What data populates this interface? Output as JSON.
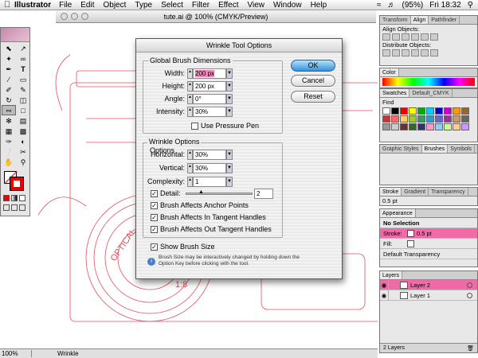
{
  "menubar": {
    "apple": "",
    "app": "Illustrator",
    "items": [
      "File",
      "Edit",
      "Object",
      "Type",
      "Select",
      "Filter",
      "Effect",
      "View",
      "Window",
      "Help"
    ],
    "battery": "(95%)",
    "clock": "Fri 18:32"
  },
  "window": {
    "title": "tute.ai @ 100% (CMYK/Preview)"
  },
  "status": {
    "zoom": "100%",
    "tool": "Wrinkle"
  },
  "dialog": {
    "title": "Wrinkle Tool Options",
    "global_group": "Global Brush Dimensions",
    "width_label": "Width:",
    "width_value": "200 px",
    "height_label": "Height:",
    "height_value": "200 px",
    "angle_label": "Angle:",
    "angle_value": "0°",
    "intensity_label": "Intensity:",
    "intensity_value": "30%",
    "pressure_label": "Use Pressure Pen",
    "wrinkle_group": "Wrinkle Options",
    "horizontal_label": "Horizontal:",
    "horizontal_value": "30%",
    "vertical_label": "Vertical:",
    "vertical_value": "30%",
    "complexity_label": "Complexity:",
    "complexity_value": "1",
    "detail_label": "Detail:",
    "detail_value": "2",
    "anchor_label": "Brush Affects Anchor Points",
    "in_tangent_label": "Brush Affects In Tangent Handles",
    "out_tangent_label": "Brush Affects Out Tangent Handles",
    "show_brush_label": "Show Brush Size",
    "note": "Brush Size may be interactively changed by holding down the Option Key before clicking with the tool.",
    "ok": "OK",
    "cancel": "Cancel",
    "reset": "Reset"
  },
  "align_panel": {
    "tabs": [
      "Transform",
      "Align",
      "Pathfinder"
    ],
    "align_objects": "Align Objects:",
    "distribute_objects": "Distribute Objects:"
  },
  "color_panel": {
    "tab": "Color"
  },
  "swatches_panel": {
    "tabs": [
      "Swatches",
      "Default_CMYK"
    ],
    "find": "Find"
  },
  "brushes_panel": {
    "tabs": [
      "Graphic Styles",
      "Brushes",
      "Symbols"
    ]
  },
  "stroke_panel": {
    "tabs": [
      "Stroke",
      "Gradient",
      "Transparency"
    ],
    "weight": "0.5 pt"
  },
  "appearance_panel": {
    "tab": "Appearance",
    "selection": "No Selection",
    "stroke_label": "Stroke:",
    "stroke_value": "0.5 pt",
    "fill_label": "Fill:",
    "transparency": "Default Transparency"
  },
  "layers_panel": {
    "tab": "Layers",
    "layers": [
      {
        "name": "Layer 2"
      },
      {
        "name": "Layer 1"
      }
    ],
    "count": "2 Layers"
  },
  "artwork": {
    "text_optical": "OPTICAL",
    "text_ratio": "1:8"
  },
  "colors": {
    "artwork_stroke": "#e05060",
    "accent_pink": "#f06aa8",
    "ok_blue": "#3a8fd8"
  }
}
